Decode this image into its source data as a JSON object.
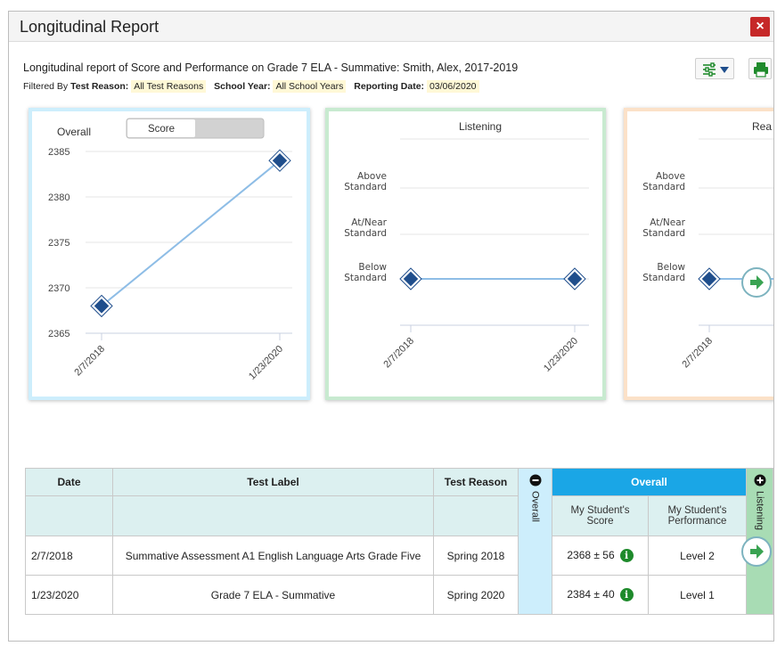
{
  "modal": {
    "title": "Longitudinal Report",
    "close_icon": "×"
  },
  "description": "Longitudinal report of Score and Performance on Grade 7 ELA - Summative: Smith, Alex, 2017-2019",
  "filters": {
    "test_reason_label": "Test Reason:",
    "test_reason_value": "All Test Reasons",
    "school_year_label": "School Year:",
    "school_year_value": "All School Years",
    "reporting_date_label": "Reporting Date:",
    "reporting_date_value": "03/06/2020"
  },
  "toolbar": {
    "settings_icon": "sliders-icon",
    "print_icon": "printer-icon"
  },
  "cards": {
    "overall": {
      "title": "Overall",
      "toggle_label": "Score",
      "border_color": "#cdeefc"
    },
    "listening": {
      "title": "Listening",
      "border_color": "#c8ead0"
    },
    "reading": {
      "title": "Rea",
      "border_color": "#fbe1c8"
    },
    "levels": {
      "above": [
        "Above",
        "Standard"
      ],
      "atnear": [
        "At/Near",
        "Standard"
      ],
      "below": [
        "Below",
        "Standard"
      ]
    }
  },
  "chart_data": [
    {
      "type": "line",
      "title": "Overall",
      "x": [
        "2/7/2018",
        "1/23/2020"
      ],
      "series": [
        {
          "values": [
            2368,
            2384
          ]
        }
      ],
      "ylim": [
        2365,
        2385
      ],
      "yticks": [
        "2385",
        "2380",
        "2375",
        "2370",
        "2365"
      ],
      "grid": true
    },
    {
      "type": "line",
      "title": "Listening",
      "x": [
        "2/7/2018",
        "1/23/2020"
      ],
      "levels": [
        "Above Standard",
        "At/Near Standard",
        "Below Standard"
      ],
      "series": [
        {
          "values": [
            "Below Standard",
            "Below Standard"
          ]
        }
      ]
    },
    {
      "type": "line",
      "title": "Rea",
      "x": [
        "2/7/2018"
      ],
      "levels": [
        "Above Standard",
        "At/Near Standard",
        "Below Standard"
      ],
      "series": [
        {
          "values": [
            "Below Standard"
          ]
        }
      ]
    }
  ],
  "table": {
    "headers": {
      "date": "Date",
      "test_label": "Test Label",
      "test_reason": "Test Reason",
      "overall_side": "Overall",
      "overall_group": "Overall",
      "listening_side": "Listening"
    },
    "subheaders": {
      "score": [
        "My Student's",
        "Score"
      ],
      "performance": [
        "My Student's",
        "Performance"
      ]
    },
    "rows": [
      {
        "date": "2/7/2018",
        "test_label": "Summative Assessment A1 English Language Arts Grade Five",
        "test_reason": "Spring 2018",
        "score": "2368 ± 56",
        "performance": "Level 2"
      },
      {
        "date": "1/23/2020",
        "test_label": "Grade 7 ELA - Summative",
        "test_reason": "Spring 2020",
        "score": "2384 ± 40",
        "performance": "Level 1"
      }
    ]
  },
  "colors": {
    "accent_blue": "#1aa6e6",
    "marker": "#1f4e8c",
    "close_red": "#c62828",
    "arrow_green": "#3aa352"
  }
}
